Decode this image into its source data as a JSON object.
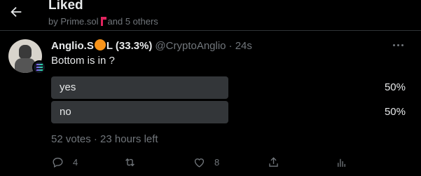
{
  "header": {
    "title": "Liked",
    "subtitle_prefix": "by Prime.sol",
    "subtitle_suffix": "and 5 others"
  },
  "tweet": {
    "author_name_start": "Anglio.S",
    "author_name_end": "L (33.3%)",
    "handle": "@CryptoAnglio",
    "time": "· 24s",
    "text": "Bottom is in ?",
    "poll": {
      "options": [
        {
          "label": "yes",
          "percent": "50%",
          "share": 0.5
        },
        {
          "label": "no",
          "percent": "50%",
          "share": 0.5
        }
      ],
      "meta": "52 votes · 23 hours left"
    },
    "actions": {
      "reply_count": "4",
      "retweet_count": "",
      "like_count": "8"
    }
  },
  "colors": {
    "background": "#000000",
    "text": "#e7e9ea",
    "muted": "#71767b",
    "poll_bar": "#333639",
    "divider": "#2f3336"
  },
  "icons": [
    "back-arrow-icon",
    "flag-icon",
    "coin-icon",
    "solana-badge-icon",
    "more-icon",
    "reply-icon",
    "retweet-icon",
    "like-icon",
    "share-icon",
    "analytics-icon"
  ]
}
